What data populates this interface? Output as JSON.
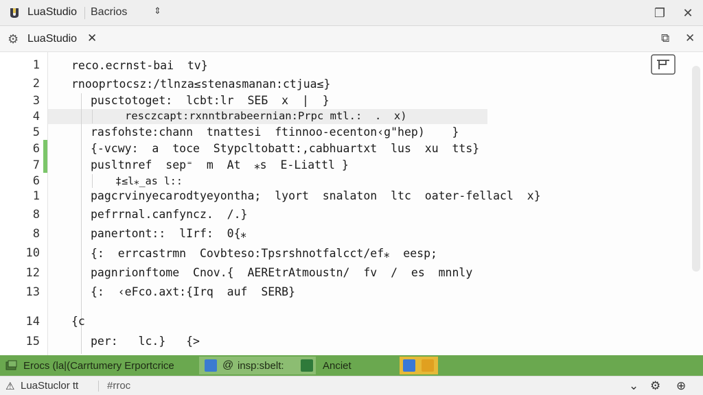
{
  "titlebar": {
    "app_name": "LuaStudio",
    "project": "Bacrios",
    "swap_icon": "⇕",
    "restore_icon": "❐",
    "close_icon": "✕"
  },
  "tab": {
    "label": "LuaStudio",
    "close": "✕",
    "gear": "⚙",
    "split_icon": "⧉",
    "close_all": "✕"
  },
  "editor": {
    "line_numbers": [
      "1",
      "2",
      "3",
      "4",
      "5",
      "6",
      "7",
      "6",
      "1",
      "8",
      "8",
      "10",
      "12",
      "13",
      "14",
      "15"
    ],
    "lines": [
      "reco.ecrnst-bai  tv}",
      "rnooprtocsz:/tlnza≤stenasmanan:c⁣tjua≤}",
      "pusctotoget:  lcbt:lr  SEБ  x  |  }",
      "resczcapt:rxnntbrabeernian:Prpc mtl.:  .  x)",
      "rasfohste:chann  tnattesi  ftinnoo-ecenton‹g\"hep)    }",
      "{-vcwy:  ⁠a  toce  Stypcltobatt:,cabhuartxt  lus  xu  tts}",
      "pusltnref  sep⁼  m  At  ⁎s  E-Liattl }",
      "⁣  ‡≤l⁎_as l::",
      "pagcrvinyecarodtyeyontha;  lyort  snalaton  ltc  oater-fellacl  x}",
      "pefrrnal.canfyncz.  /.}",
      "panertont::  lIrf:  0{⁎",
      "{:  errcastrmn  Covbteso:Tpsrshnotfalcct/ef⁎  eesp;",
      "pagnrionftome  Cnov.{  AEREtrAtmoustn/  fv  /  es  mnnly",
      "{:  ‹eFco.axt:{Irq  auf  SERB}",
      "{c",
      "per:   lc.}   {>"
    ]
  },
  "statusbar": {
    "errors": "Erocs (la|(Carrtumery Erportcrice",
    "center": "insp:sbelt:",
    "right": "Anciet"
  },
  "bottombar": {
    "workspace": "LuaStuclor tt",
    "tag": "#rroc",
    "chevron": "⌄",
    "settings": "⚙",
    "help": "⊕"
  }
}
